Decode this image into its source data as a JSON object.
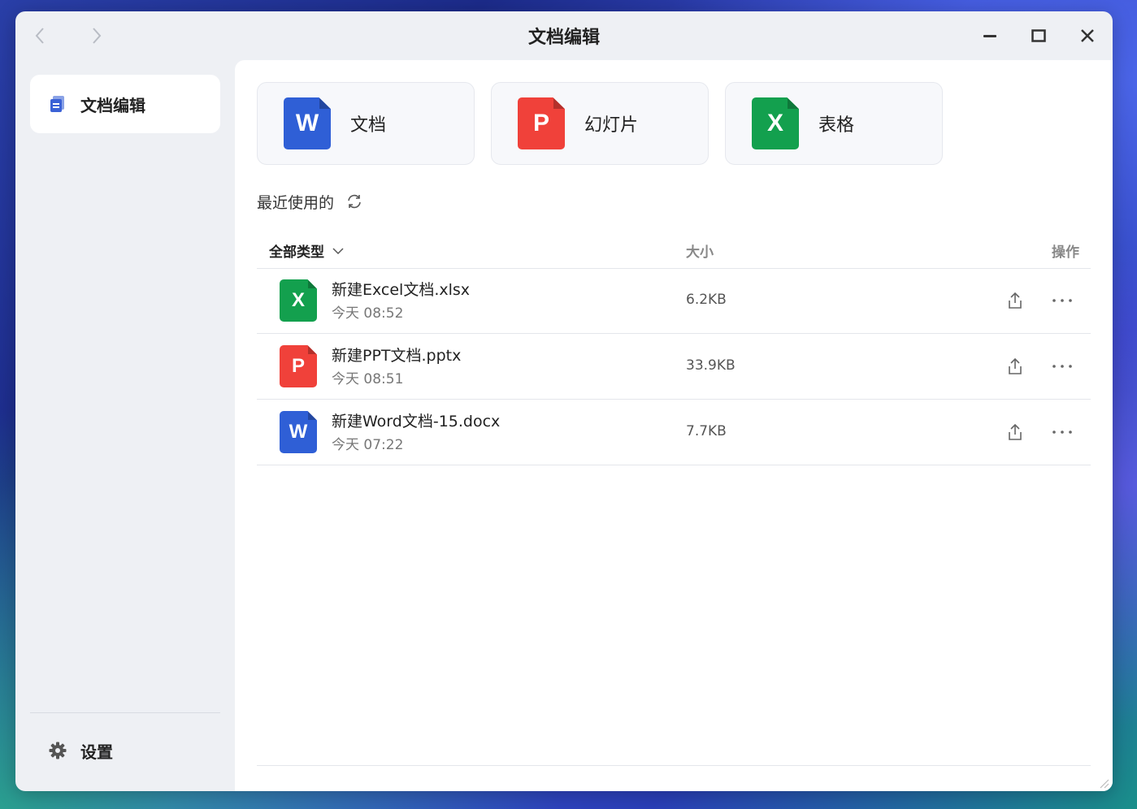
{
  "window": {
    "title": "文档编辑"
  },
  "sidebar": {
    "items": [
      {
        "label": "文档编辑",
        "icon": "document-stack-icon",
        "active": true
      }
    ],
    "settings_label": "设置"
  },
  "create_cards": [
    {
      "label": "文档",
      "type": "word",
      "letter": "W",
      "color": "#2f5fd6"
    },
    {
      "label": "幻灯片",
      "type": "ppt",
      "letter": "P",
      "color": "#f0413a"
    },
    {
      "label": "表格",
      "type": "xls",
      "letter": "X",
      "color": "#13a04e"
    }
  ],
  "recent": {
    "title": "最近使用的",
    "columns": {
      "type": "全部类型",
      "size": "大小",
      "ops": "操作"
    },
    "files": [
      {
        "name": "新建Excel文档.xlsx",
        "time": "今天 08:52",
        "size": "6.2KB",
        "type": "xls",
        "letter": "X"
      },
      {
        "name": "新建PPT文档.pptx",
        "time": "今天 08:51",
        "size": "33.9KB",
        "type": "ppt",
        "letter": "P"
      },
      {
        "name": "新建Word文档-15.docx",
        "time": "今天 07:22",
        "size": "7.7KB",
        "type": "word",
        "letter": "W"
      }
    ]
  }
}
